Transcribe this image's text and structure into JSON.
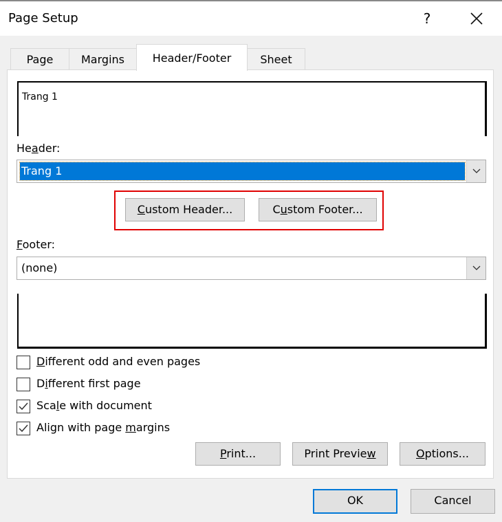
{
  "window": {
    "title": "Page Setup",
    "help_label": "?",
    "close_icon": "close-icon"
  },
  "tabs": [
    {
      "label": "Page",
      "active": false
    },
    {
      "label": "Margins",
      "active": false
    },
    {
      "label": "Header/Footer",
      "active": true
    },
    {
      "label": "Sheet",
      "active": false
    }
  ],
  "header_preview": {
    "text": "Trang 1"
  },
  "header": {
    "label_pre": "He",
    "label_accel": "a",
    "label_post": "der:",
    "selected_value": "Trang 1"
  },
  "custom_buttons": {
    "custom_header": {
      "accel": "C",
      "rest": "ustom Header..."
    },
    "custom_footer": {
      "pre": "C",
      "accel": "u",
      "rest": "stom Footer..."
    }
  },
  "footer": {
    "label_accel": "F",
    "label_post": "ooter:",
    "selected_value": "(none)"
  },
  "footer_preview": {
    "text": ""
  },
  "checkboxes": [
    {
      "pre": "",
      "accel": "D",
      "post": "ifferent odd and even pages",
      "checked": false
    },
    {
      "pre": "D",
      "accel": "i",
      "post": "fferent first page",
      "checked": false
    },
    {
      "pre": "Sca",
      "accel": "l",
      "post": "e with document",
      "checked": true
    },
    {
      "pre": "Align with page ",
      "accel": "m",
      "post": "argins",
      "checked": true
    }
  ],
  "panel_buttons": {
    "print": {
      "pre": "",
      "accel": "P",
      "post": "rint..."
    },
    "print_preview": {
      "pre": "Print Previe",
      "accel": "w",
      "post": ""
    },
    "options": {
      "pre": "",
      "accel": "O",
      "post": "ptions..."
    }
  },
  "dialog_buttons": {
    "ok": "OK",
    "cancel": "Cancel"
  },
  "colors": {
    "selection": "#0078d7",
    "highlight_box": "#e00000",
    "default_button_border": "#0078d7"
  }
}
